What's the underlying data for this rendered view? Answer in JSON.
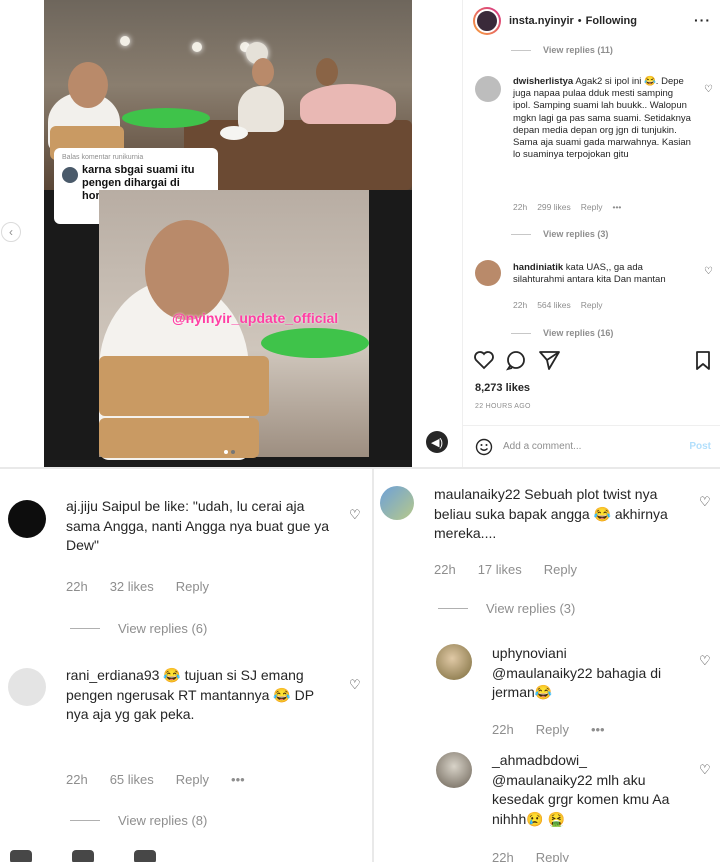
{
  "post": {
    "username": "insta.nyinyir",
    "separator": "•",
    "follow_status": "Following",
    "more_icon": "more-horizontal-icon",
    "video": {
      "comment_card": {
        "reply_to": "Balas komentar runikurnia",
        "text": "karna sbgai suami itu pengen dihargai di hormati"
      },
      "watermark": "@nyinyir_update_official"
    },
    "side_comments": [
      {
        "view_replies": "View replies (11)"
      },
      {
        "username": "dwisherlistya",
        "text": "Agak2 si ipol ini 😂. Depe juga napaa pulaa dduk mesti samping ipol. Samping suami lah buukk.. Walopun mgkn lagi ga pas sama suami. Setidaknya depan media depan org jgn di tunjukin. Sama aja suami gada marwahnya. Kasian lo suaminya terpojokan gitu",
        "time": "22h",
        "likes": "299 likes",
        "reply": "Reply",
        "view_replies": "View replies (3)"
      },
      {
        "username": "handiniatik",
        "text": "kata UAS,, ga ada silahturahmi antara kita Dan mantan",
        "time": "22h",
        "likes": "564 likes",
        "reply": "Reply",
        "view_replies": "View replies (16)"
      }
    ],
    "likes_count": "8,273 likes",
    "timestamp": "22 HOURS AGO",
    "add_comment_placeholder": "Add a comment...",
    "post_button": "Post"
  },
  "comments_left": [
    {
      "username": "aj.jiju",
      "text": "Saipul be like: \"udah, lu cerai aja sama Angga, nanti Angga nya buat gue ya Dew\"",
      "time": "22h",
      "likes": "32 likes",
      "reply": "Reply",
      "view_replies": "View replies (6)"
    },
    {
      "username": "rani_erdiana93",
      "text": "😂 tujuan si SJ emang pengen ngerusak RT mantannya 😂 DP nya aja yg gak peka.",
      "time": "22h",
      "likes": "65 likes",
      "reply": "Reply",
      "more": "•••",
      "view_replies": "View replies (8)"
    }
  ],
  "comments_right": [
    {
      "username": "maulanaiky22",
      "text": "Sebuah plot twist nya beliau suka bapak angga 😂 akhirnya mereka....",
      "time": "22h",
      "likes": "17 likes",
      "reply": "Reply",
      "view_replies": "View replies (3)"
    },
    {
      "username": "uphynoviani",
      "text": "@maulanaiky22 bahagia di jerman😂",
      "time": "22h",
      "reply": "Reply",
      "more": "•••"
    },
    {
      "username": "_ahmadbdowi_",
      "text": "@maulanaiky22 mlh aku kesedak grgr komen kmu Aa nihhh😢 🤮",
      "time": "22h",
      "reply": "Reply"
    }
  ],
  "colors": {
    "text": "#262626",
    "muted": "#8e8e8e",
    "watermark": "#ff3fa4",
    "post_disabled": "#b2dffc"
  }
}
